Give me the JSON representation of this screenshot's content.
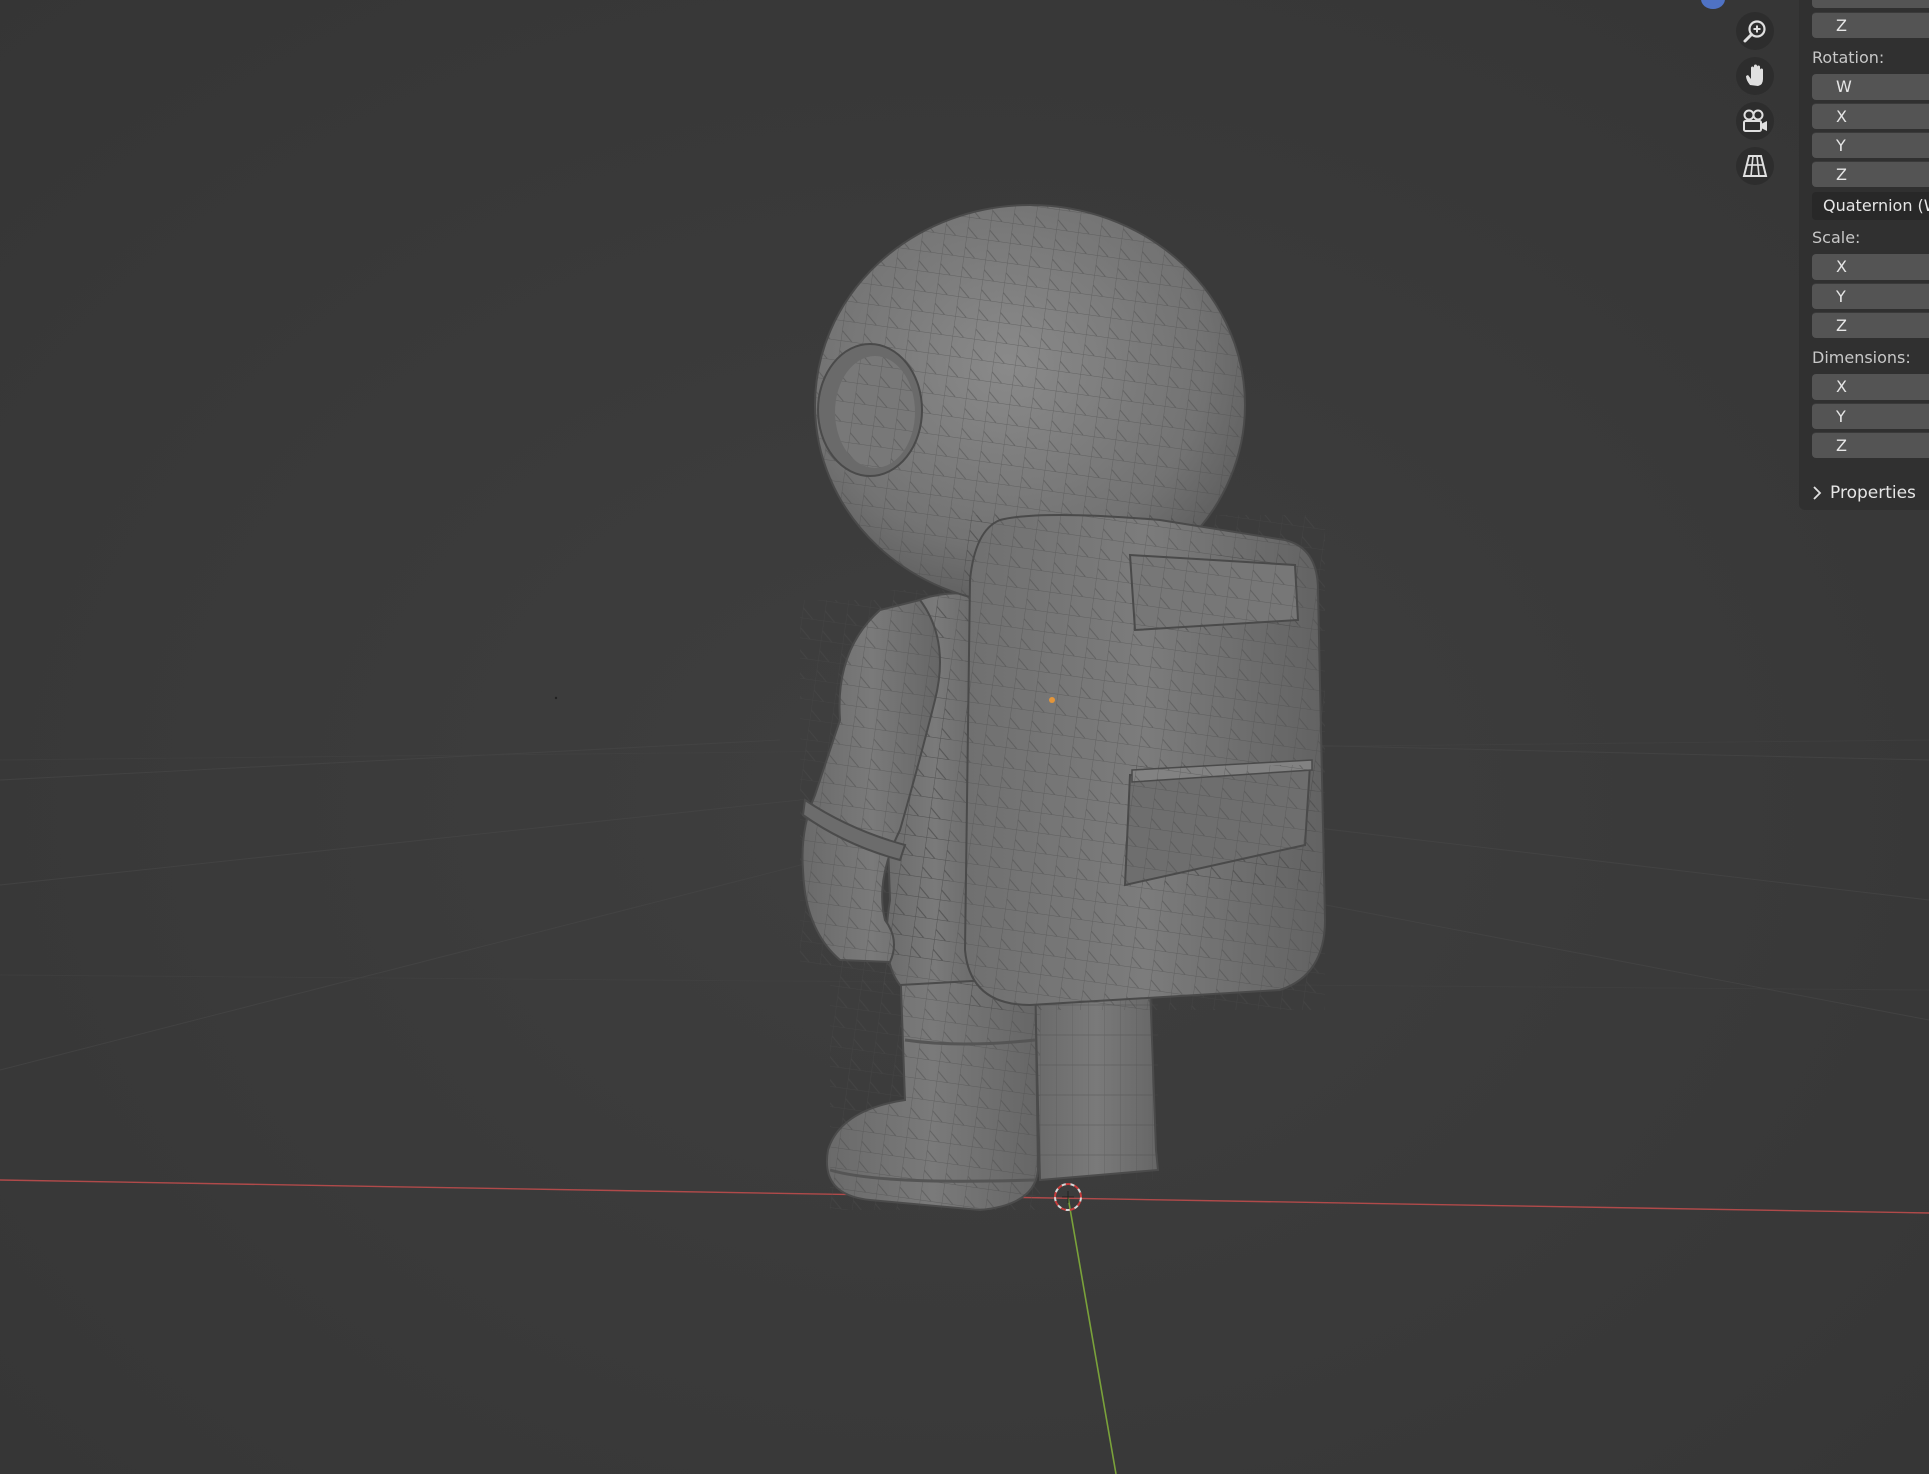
{
  "npanel": {
    "location_z": "Z",
    "rotation_label": "Rotation:",
    "rotation_fields": [
      "W",
      "X",
      "Y",
      "Z"
    ],
    "rotation_mode": "Quaternion (W",
    "scale_label": "Scale:",
    "scale_fields": [
      "X",
      "Y",
      "Z"
    ],
    "dimensions_label": "Dimensions:",
    "dimensions_fields": [
      "X",
      "Y",
      "Z"
    ],
    "properties_label": "Properties"
  },
  "nav_gizmo": {
    "icons": [
      "zoom-icon",
      "hand-pan-icon",
      "camera-view-icon",
      "perspective-grid-icon"
    ],
    "axis_color": "#4f72c4"
  },
  "viewport": {
    "background": "#3a3a3a",
    "x_axis_color": "#b04a4a",
    "y_axis_color": "#7aa23a",
    "model": "astronaut"
  }
}
